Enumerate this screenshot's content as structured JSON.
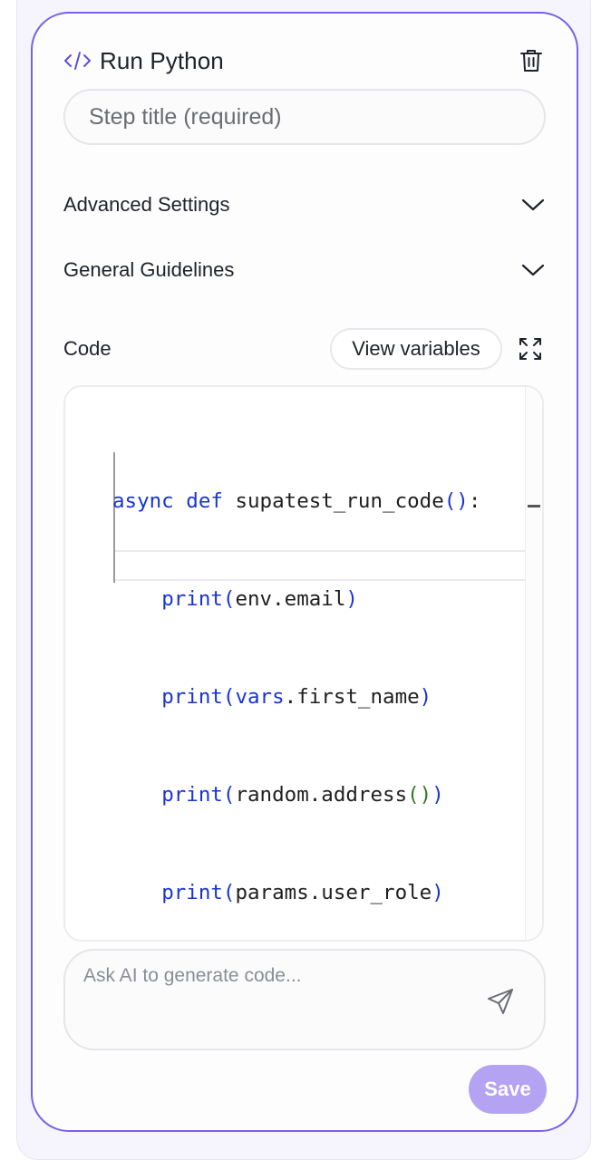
{
  "header": {
    "step_type": "Run Python",
    "code_icon": "code-brackets-icon",
    "delete_icon": "trash-icon"
  },
  "title_input": {
    "placeholder": "Step title (required)",
    "value": ""
  },
  "accordions": [
    {
      "label": "Advanced Settings",
      "icon": "chevron-down-icon"
    },
    {
      "label": "General Guidelines",
      "icon": "chevron-down-icon"
    }
  ],
  "code_section": {
    "label": "Code",
    "view_variables_label": "View variables",
    "expand_icon": "expand-icon"
  },
  "code": {
    "lines": [
      "async def supatest_run_code():",
      "    print(env.email)",
      "    print(vars.first_name)",
      "    print(random.address())",
      "    print(params.user_role)"
    ]
  },
  "ai": {
    "placeholder": "Ask AI to generate code...",
    "send_icon": "send-icon"
  },
  "save_label": "Save",
  "colors": {
    "accent": "#7b61e8",
    "save_bg": "#b3a3f2",
    "keyword": "#1a34d2",
    "bracket_inner": "#2f7a1f"
  }
}
